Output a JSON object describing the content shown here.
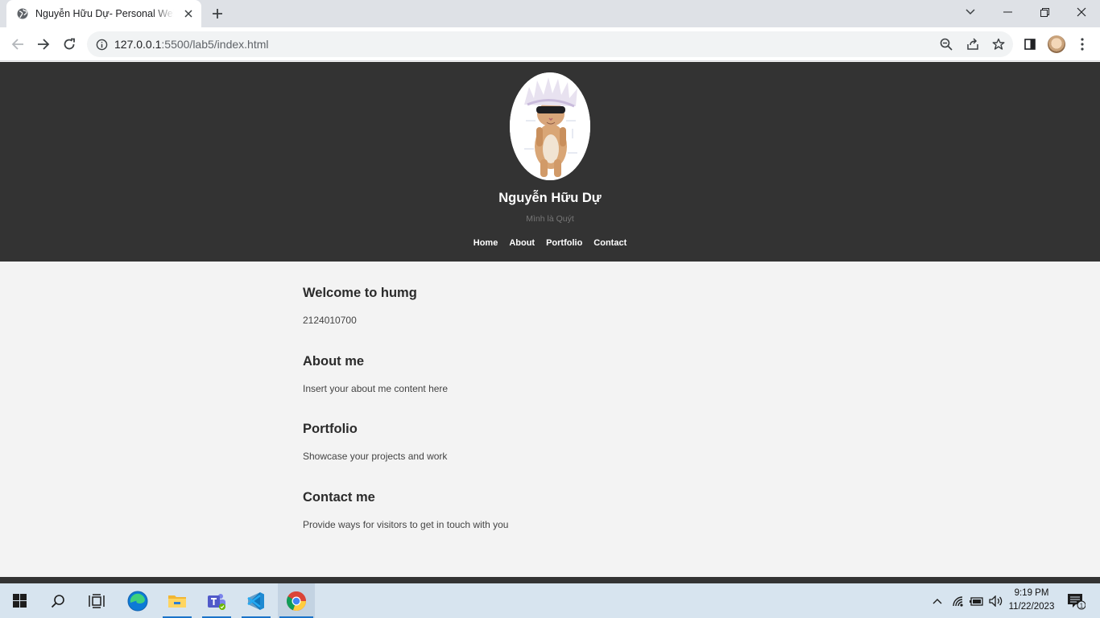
{
  "browser": {
    "tab_title": "Nguyễn Hữu Dự- Personal Website",
    "url_host": "127.0.0.1",
    "url_rest": ":5500/lab5/index.html"
  },
  "site": {
    "name": "Nguyễn Hữu Dự",
    "subtitle": "Mình là Quýt",
    "nav": [
      "Home",
      "About",
      "Portfolio",
      "Contact"
    ]
  },
  "sections": [
    {
      "heading": "Welcome to humg",
      "text": "2124010700"
    },
    {
      "heading": "About me",
      "text": "Insert your about me content here"
    },
    {
      "heading": "Portfolio",
      "text": "Showcase your projects and work"
    },
    {
      "heading": "Contact me",
      "text": "Provide ways for visitors to get in touch with you"
    }
  ],
  "taskbar": {
    "time": "9:19 PM",
    "date": "11/22/2023",
    "notification_count": "1"
  },
  "colors": {
    "header_bg": "#333333",
    "page_bg": "#f3f3f3",
    "taskbar_bg": "#d7e4ef"
  }
}
